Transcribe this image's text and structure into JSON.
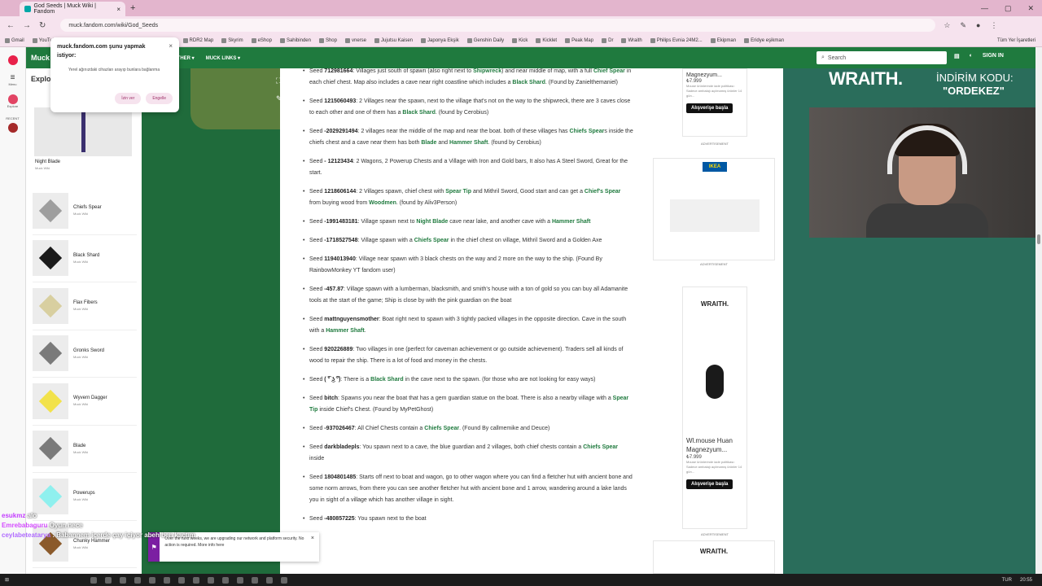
{
  "browser": {
    "tab_title": "God Seeds | Muck Wiki | Fandom",
    "url": "muck.fandom.com/wiki/God_Seeds",
    "bookmarks": [
      "Gmail",
      "YouTube",
      "Haritalar",
      "PV",
      "SteamDB",
      "HLTB",
      "RDR2 Map",
      "Skyrim",
      "eShop",
      "Sahibinden",
      "Shop",
      "vnerse",
      "Jujutsu Kaisen",
      "Japonya Ekşik",
      "Genshin Daily",
      "Kick",
      "Kicklet",
      "Peak Map",
      "Dr",
      "Wraith",
      "Philips Evnia 24M2...",
      "Ekipman",
      "Eridye eşikman"
    ],
    "all_bookmarks": "Tüm Yer İşaretleri"
  },
  "permission": {
    "title": "muck.fandom.com şunu yapmak istiyor:",
    "desc": "Yerel ağınızdaki cihazları arayıp bunlara bağlanma",
    "allow": "İzin ver",
    "block": "Engelle"
  },
  "fandom": {
    "logo": "Muck",
    "nav": [
      "OTHER ▾",
      "MUCK LINKS ▾"
    ],
    "search_placeholder": "Search",
    "sign_in": "SIGN IN"
  },
  "rail": {
    "menu": "Menu",
    "explore": "Explore",
    "recent": "RECENT"
  },
  "sidepanel": {
    "title": "Explo",
    "first": {
      "title": "Night Blade",
      "sub": "Muck Wiki"
    },
    "items": [
      {
        "title": "Chiefs Spear",
        "sub": "Muck Wiki"
      },
      {
        "title": "Black Shard",
        "sub": "Muck Wiki"
      },
      {
        "title": "Flax Fibers",
        "sub": "Muck Wiki"
      },
      {
        "title": "Gronks Sword",
        "sub": "Muck Wiki"
      },
      {
        "title": "Wyvern Dagger",
        "sub": "Muck Wiki"
      },
      {
        "title": "Blade",
        "sub": "Muck Wiki"
      },
      {
        "title": "Powerups",
        "sub": "Muck Wiki"
      },
      {
        "title": "Chunky Hammer",
        "sub": "Muck Wiki"
      }
    ]
  },
  "article": {
    "seeds": [
      {
        "pre": "Seed ",
        "seed": "712981664",
        "text": ": Villages just south of spawn (also right next to Shipwreck) and near middle of map, with a full Chief Spear in each chief chest. Map also includes a cave near right coastline which includes a Black Shard. (Found by Zanielthemaniel)"
      },
      {
        "pre": "Seed ",
        "seed": "1215060493",
        "text": ": 2 Villages near the spawn, next to the village that's not on the way to the shipwreck, there are 3 caves close to each other and one of them has a Black Shard. (found by Cerobius)"
      },
      {
        "pre": "Seed ",
        "seed": "-2029291494",
        "text": ": 2 villages near the middle of the map and near the boat. both of these villages has Chiefs Spears inside the chiefs chest and a cave near them has both Blade and Hammer Shaft. (found by Cerobius)"
      },
      {
        "pre": "Seed ",
        "seed": "- 12123434",
        "text": ": 2 Wagons, 2 Powerup Chests and a Village with Iron and Gold bars, It also has A Steel Sword, Great for the start."
      },
      {
        "pre": "Seed ",
        "seed": "1218606144",
        "text": ": 2 Villages spawn, chief chest with Spear Tip and Mithril Sword, Good start and can get a Chief's Spear from buying wood from Woodmen. (found by Aliv3Person)"
      },
      {
        "pre": "Seed ",
        "seed": "-1991483181",
        "text": ": Village spawn next to Night Blade cave near lake, and another cave with a Hammer Shaft"
      },
      {
        "pre": "Seed ",
        "seed": "-1718527548",
        "text": ": Village spawn with a Chiefs Spear in the chief chest on village, Mithril Sword and a Golden Axe"
      },
      {
        "pre": "Seed ",
        "seed": "1194013940",
        "text": ": Village near spawn with 3 black chests on the way and 2 more on the way to the ship. (Found By RainbowMonkey YT fandom user)"
      },
      {
        "pre": "Seed ",
        "seed": "-457.87",
        "text": ": Village spawn with a lumberman, blacksmith, and smith's house with a ton of gold so you can buy all Adamanite tools at the start of the game; Ship is close by with the pink guardian on the boat"
      },
      {
        "pre": "Seed ",
        "seed": "mattnguyensmother",
        "text": ": Boat right next to spawn with 3 tightly packed villages in the opposite direction. Cave in the south with a Hammer Shaft."
      },
      {
        "pre": "Seed ",
        "seed": "920226889",
        "text": ": Two villages in one (perfect for caveman achievement or go outside achievement). Traders sell all kinds of wood to repair the ship. There is a lot of food and money in the chests."
      },
      {
        "pre": "Seed ",
        "seed": "( ͡° ͜ʖ ͡°)",
        "text": ": There is a Black Shard in the cave next to the spawn. (for those who are not looking for easy ways)"
      },
      {
        "pre": "Seed ",
        "seed": "bitch",
        "text": ": Spawns you near the boat that has a gem guardian statue on the boat. There is also a nearby village with a Spear Tip inside Chief's Chest. (Found by MyPetGhost)"
      },
      {
        "pre": "Seed ",
        "seed": "-937026467",
        "text": ": All Chief Chests contain a Chiefs Spear. (Found By callmemike and Deuce)"
      },
      {
        "pre": "Seed ",
        "seed": "darkbladepls",
        "text": ": You spawn next to a cave, the blue guardian and 2 villages, both chief chests contain a Chiefs Spear inside"
      },
      {
        "pre": "Seed ",
        "seed": "1804801485",
        "text": ": Starts off next to boat and wagon, go to other wagon where you can find a fletcher hut with ancient bone and some norm arrows, from there you can see another fletcher hut with ancient bone and 1 arrow, wandering around a lake lands you in sight of a village which has another village in sight."
      },
      {
        "pre": "Seed ",
        "seed": "-480857225",
        "text": ": You spawn next to the boat"
      }
    ]
  },
  "ads": {
    "top": {
      "title": "Magnezyum...",
      "price": "₺7.999",
      "small": "Mouse ürünlerinde iade politikası: Sadece ambalajı açılmamış ürünler 14 gün...",
      "btn": "Alışverişe başla",
      "label": "ADVERTISEMENT"
    },
    "ikea": {
      "brand": "IKEA",
      "label": "ADVERTISEMENT"
    },
    "wraith": {
      "brand": "WRAITH.",
      "title": "Wl.mouse Huan Magnezyum...",
      "price": "₺7.999",
      "small": "Mouse ürünlerinde iade politikası: Sadece ambalajı açılmamış ürünler 14 gün...",
      "btn": "Alışverişe başla",
      "label": "ADVERTISEMENT"
    },
    "wraith2": {
      "brand": "WRAITH."
    }
  },
  "banner": {
    "brand": "WRAITH.",
    "code_label": "İNDİRİM KODU:",
    "code": "\"ORDEKEZ\""
  },
  "notice": {
    "text": "Over the next weeks, we are upgrading our network and platform security. No action is required. More info here"
  },
  "chat": [
    {
      "user": "esukmz",
      "msg": "alo",
      "color": "#c33cff"
    },
    {
      "user": "Emrebabaguru",
      "msg": "Oyun nece",
      "color": "#d44bff"
    },
    {
      "user": "ceylabeteatarya",
      "msg": ": Babannem içerde çay içiyor abeh ben kaçtım",
      "color": "#b06bff"
    }
  ],
  "taskbar": {
    "lang": "TUR",
    "time": "20:55"
  },
  "colors": {
    "fandom_green": "#1f7a3e",
    "banner_bg": "#2a6d5b",
    "tab_pink": "#e3b5cd"
  }
}
